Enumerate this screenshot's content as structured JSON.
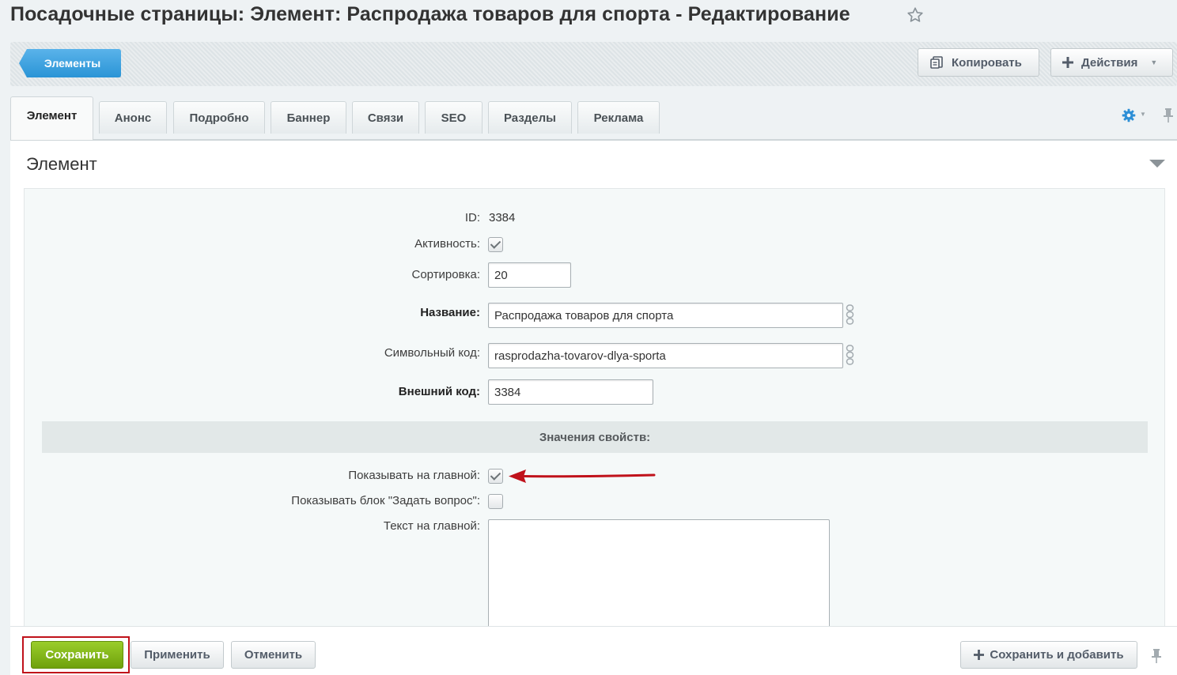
{
  "page": {
    "title": "Посадочные страницы: Элемент: Распродажа товаров для спорта - Редактирование"
  },
  "toolbar": {
    "elements_label": "Элементы",
    "copy_label": "Копировать",
    "actions_label": "Действия"
  },
  "tabs": [
    {
      "label": "Элемент",
      "active": true
    },
    {
      "label": "Анонс",
      "active": false
    },
    {
      "label": "Подробно",
      "active": false
    },
    {
      "label": "Баннер",
      "active": false
    },
    {
      "label": "Связи",
      "active": false
    },
    {
      "label": "SEO",
      "active": false
    },
    {
      "label": "Разделы",
      "active": false
    },
    {
      "label": "Реклама",
      "active": false
    }
  ],
  "section": {
    "title": "Элемент"
  },
  "form": {
    "id_label": "ID:",
    "id_value": "3384",
    "active_label": "Активность:",
    "active_checked": true,
    "sort_label": "Сортировка:",
    "sort_value": "20",
    "name_label": "Название:",
    "name_value": "Распродажа товаров для спорта",
    "code_label": "Символьный код:",
    "code_value": "rasprodazha-tovarov-dlya-sporta",
    "xml_id_label": "Внешний код:",
    "xml_id_value": "3384"
  },
  "properties": {
    "header": "Значения свойств:",
    "show_main_label": "Показывать на главной:",
    "show_main_checked": true,
    "show_question_label": "Показывать блок \"Задать вопрос\":",
    "show_question_checked": false,
    "main_text_label": "Текст на главной:",
    "main_text_value": ""
  },
  "footer": {
    "save_label": "Сохранить",
    "apply_label": "Применить",
    "cancel_label": "Отменить",
    "save_add_label": "Сохранить и добавить"
  },
  "icons": {
    "favorite": "star-icon",
    "copy": "copy-icon",
    "add": "plus-icon",
    "settings": "gear-icon",
    "pin": "pin-icon",
    "collapse": "collapse-icon",
    "link": "link-icon"
  },
  "colors": {
    "primary_blue": "#2a94d6",
    "save_green": "#7cb518",
    "annotation_red": "#c0121b",
    "gear_blue": "#2d8fd6"
  }
}
